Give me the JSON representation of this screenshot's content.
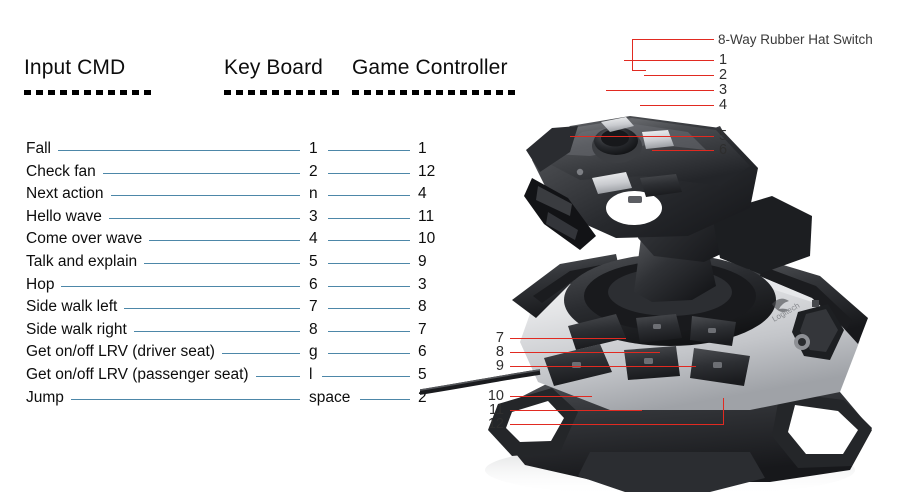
{
  "table": {
    "headers": {
      "input_cmd": "Input CMD",
      "key_board": "Key Board",
      "game_controller": "Game Controller"
    },
    "rows": [
      {
        "cmd": "Fall",
        "key": "1",
        "pad": "1"
      },
      {
        "cmd": "Check fan",
        "key": "2",
        "pad": "12"
      },
      {
        "cmd": "Next action",
        "key": "n",
        "pad": "4"
      },
      {
        "cmd": "Hello wave",
        "key": "3",
        "pad": "11"
      },
      {
        "cmd": "Come over wave",
        "key": "4",
        "pad": "10"
      },
      {
        "cmd": "Talk and explain",
        "key": "5",
        "pad": "9"
      },
      {
        "cmd": "Hop",
        "key": "6",
        "pad": "3"
      },
      {
        "cmd": "Side walk left",
        "key": "7",
        "pad": "8"
      },
      {
        "cmd": "Side walk right",
        "key": "8",
        "pad": "7"
      },
      {
        "cmd": "Get on/off LRV (driver seat)",
        "key": "g",
        "pad": "6"
      },
      {
        "cmd": "Get on/off LRV (passenger seat)",
        "key": "l",
        "pad": "5"
      },
      {
        "cmd": "Jump",
        "key": "space",
        "pad": "2"
      }
    ]
  },
  "callouts": {
    "hat_switch_label": "8-Way Rubber Hat Switch",
    "right_numbers": [
      "1",
      "2",
      "3",
      "4",
      "5",
      "6"
    ],
    "left_numbers": [
      "7",
      "8",
      "9",
      "10",
      "11",
      "12"
    ]
  },
  "colors": {
    "callout_red": "#e12a21",
    "leader_blue": "#4d87a8",
    "text_black": "#0d0d0d",
    "background": "#ffffff"
  },
  "photo": {
    "device": "flight-joystick",
    "brand_mark": "logitech-logo"
  }
}
